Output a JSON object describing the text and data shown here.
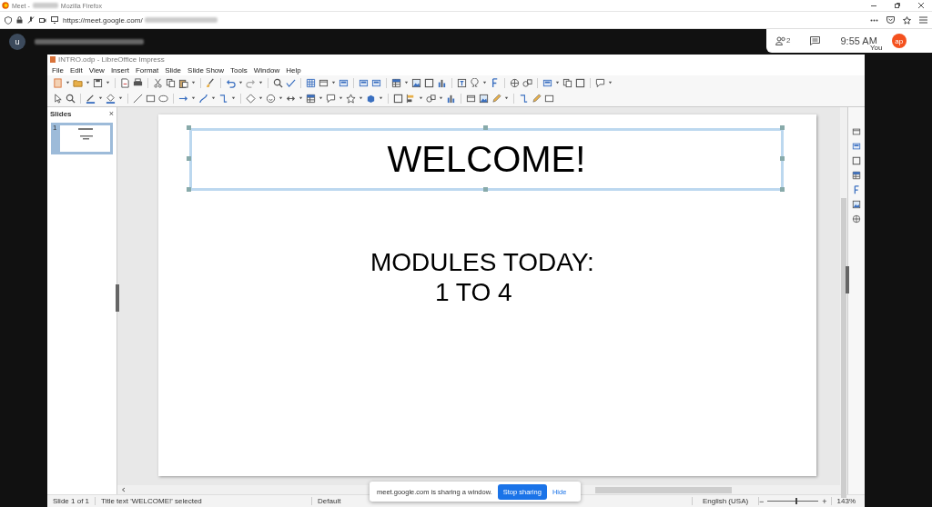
{
  "browser": {
    "title_prefix": "Meet -",
    "title_suffix": "Mozilla Firefox",
    "url": "https://meet.google.com/"
  },
  "meet": {
    "user_initial": "u",
    "participants_count": "2",
    "time": "9:55 AM",
    "self_avatar": "ap",
    "self_label": "You"
  },
  "impress": {
    "title": "INTRO.odp - LibreOffice Impress",
    "menu": [
      "File",
      "Edit",
      "View",
      "Insert",
      "Format",
      "Slide",
      "Slide Show",
      "Tools",
      "Window",
      "Help"
    ],
    "slides_panel": {
      "title": "Slides",
      "close": "×",
      "thumbnails": [
        {
          "number": "1",
          "selected": true
        }
      ]
    },
    "slide": {
      "title": "WELCOME!",
      "title_selected": true,
      "body_lines": [
        "MODULES TODAY:",
        "1 TO 4"
      ]
    },
    "status_bar": {
      "slide": "Slide 1 of 1",
      "selection": "Title text 'WELCOME!' selected",
      "master": "Default",
      "language": "English (USA)",
      "zoom": "143%",
      "zoom_out": "−",
      "zoom_in": "+",
      "zoom_slider": {
        "level": 0.55
      }
    }
  },
  "sharing_banner": {
    "message": "meet.google.com is sharing a window.",
    "stop_button": "Stop sharing",
    "hide_link": "Hide"
  }
}
